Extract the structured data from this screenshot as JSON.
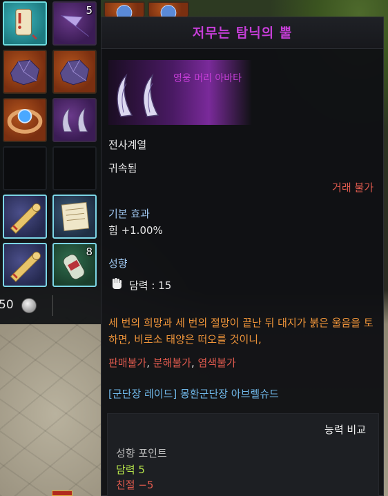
{
  "inventory": {
    "slots": [
      {
        "id": "scroll-teal",
        "count": ""
      },
      {
        "id": "purple-feather",
        "count": "5"
      },
      {
        "id": "crystal-top-1",
        "count": ""
      },
      {
        "id": "crystal-top-2",
        "count": ""
      },
      {
        "id": "ore-1",
        "count": ""
      },
      {
        "id": "ore-2",
        "count": ""
      },
      {
        "id": "gem-bracelet",
        "count": ""
      },
      {
        "id": "avatar-horns",
        "count": ""
      },
      {
        "id": "empty-1",
        "count": ""
      },
      {
        "id": "empty-2",
        "count": ""
      },
      {
        "id": "scroll-1",
        "count": ""
      },
      {
        "id": "paper-note",
        "count": ""
      },
      {
        "id": "scroll-2",
        "count": ""
      },
      {
        "id": "grenade-potion",
        "count": "8"
      }
    ],
    "currency_amount": "50"
  },
  "tooltip": {
    "title": "저무는 탐닉의 뿔",
    "subtitle": "영웅 머리 아바타",
    "class_req": "전사계열",
    "bind": "귀속됨",
    "trade": "거래 불가",
    "base_effect_label": "기본 효과",
    "base_effect_value": "힘 +1.00%",
    "tendency_label": "성향",
    "tendency_value": "담력 : 15",
    "flavor": "세 번의 희망과 세 번의 절망이 끝난 뒤 대지가 붉은 울음을 토하면, 비로소 태양은 떠오를 것이니,",
    "restrictions": [
      "판매불가",
      "분해불가",
      "염색불가"
    ],
    "source": "[군단장 레이드] 몽환군단장 아브렐슈드",
    "compare": {
      "title": "능력 비교",
      "points_label": "성향 포인트",
      "gain": "담력 5",
      "loss": "친절 −5"
    }
  },
  "colors": {
    "title": "#c63ed8",
    "label": "#9fc7f0",
    "warning": "#e05a4e",
    "flavor": "#f0953a",
    "source": "#6fb7e8",
    "gain": "#b6e44a"
  }
}
